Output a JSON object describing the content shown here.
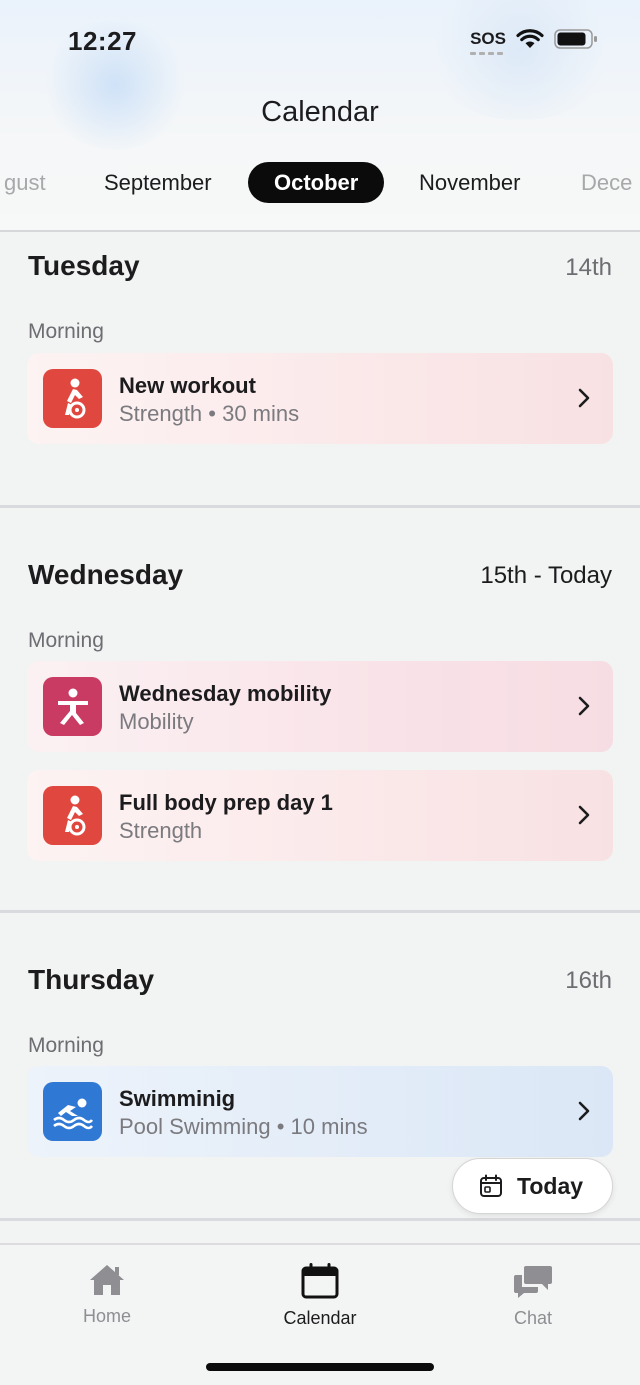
{
  "status_bar": {
    "time": "12:27",
    "sos": "SOS"
  },
  "header": {
    "title": "Calendar"
  },
  "months": [
    "gust",
    "September",
    "October",
    "November",
    "Dece"
  ],
  "active_month": "October",
  "days": [
    {
      "name": "Tuesday",
      "date": "14th",
      "period": "Morning",
      "workouts": [
        {
          "title": "New workout",
          "subtitle": "Strength • 30 mins",
          "icon": "weightlifting-icon",
          "icon_color": "#e0473f"
        }
      ]
    },
    {
      "name": "Wednesday",
      "date": "15th  - Today",
      "period": "Morning",
      "workouts": [
        {
          "title": "Wednesday mobility",
          "subtitle": "Mobility",
          "icon": "stretching-figure-icon",
          "icon_color": "#c93b63"
        },
        {
          "title": "Full body prep day 1",
          "subtitle": "Strength",
          "icon": "weightlifting-icon",
          "icon_color": "#e0473f"
        }
      ]
    },
    {
      "name": "Thursday",
      "date": "16th",
      "period": "Morning",
      "workouts": [
        {
          "title": "Swimminig",
          "subtitle": "Pool Swimming • 10 mins",
          "icon": "swimmer-icon",
          "icon_color": "#2f78d4"
        }
      ]
    }
  ],
  "today_button": {
    "label": "Today"
  },
  "tabbar": {
    "tabs": [
      {
        "label": "Home",
        "icon": "house-icon",
        "active": false
      },
      {
        "label": "Calendar",
        "icon": "calendar-icon",
        "active": true
      },
      {
        "label": "Chat",
        "icon": "chat-bubbles-icon",
        "active": false
      }
    ]
  },
  "colors": {
    "active_pill": "#0b0b0b",
    "strength": "#e0473f",
    "mobility": "#c93b63",
    "swimming": "#2f78d4"
  }
}
